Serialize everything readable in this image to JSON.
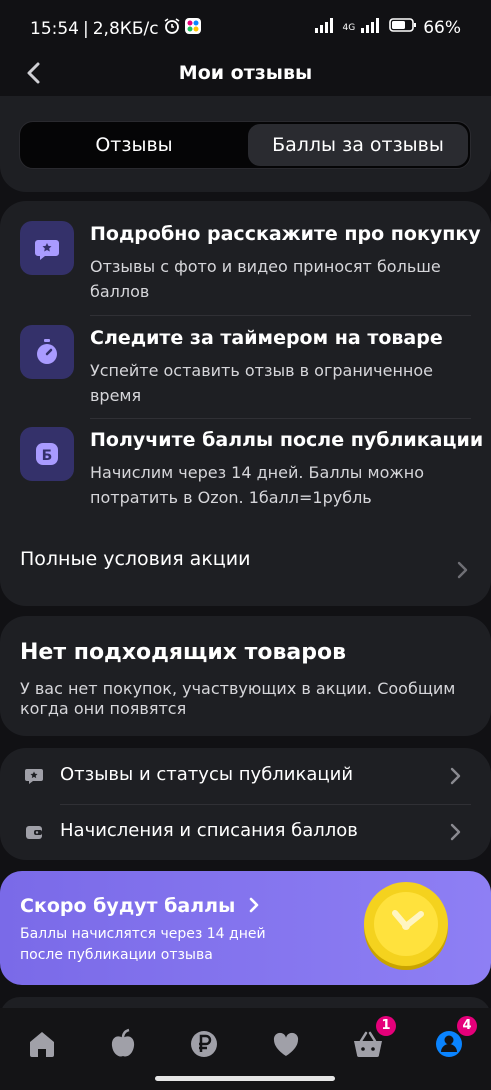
{
  "status_bar": {
    "time": "15:54",
    "speed": "2,8КБ/с",
    "network": "4G",
    "battery": "66%"
  },
  "header": {
    "title": "Мои отзывы"
  },
  "tabs": [
    {
      "label": "Отзывы",
      "active": false
    },
    {
      "label": "Баллы за отзывы",
      "active": true
    }
  ],
  "info": {
    "rows": [
      {
        "title": "Подробно расскажите про покупку",
        "text": "Отзывы с фото и видео приносят больше баллов",
        "icon": "star-chat-icon"
      },
      {
        "title": "Следите за таймером на товаре",
        "text": "Успейте оставить отзыв в ограниченное время",
        "icon": "stopwatch-icon"
      },
      {
        "title": "Получите баллы после публикации",
        "text": "Начислим через 14 дней. Баллы можно потратить в Ozon. 1балл=1рубль",
        "icon": "ruble-b-icon",
        "icon_letter": "Б"
      }
    ],
    "conditions_label": "Полные условия акции"
  },
  "no_products": {
    "title": "Нет подходящих товаров",
    "text": "У вас нет покупок, участвующих в акции. Сообщим когда они появятся"
  },
  "links": [
    {
      "label": "Отзывы и статусы публикаций",
      "icon": "star-chat-icon"
    },
    {
      "label": "Начисления и списания баллов",
      "icon": "wallet-icon"
    }
  ],
  "promo": {
    "title": "Скоро будут баллы",
    "text": "Баллы начислятся через 14 дней после публикации отзыва",
    "background": "#8576f0"
  },
  "nav": [
    {
      "name": "home-icon"
    },
    {
      "name": "fresh-icon"
    },
    {
      "name": "ruble-icon"
    },
    {
      "name": "heart-icon"
    },
    {
      "name": "basket-icon",
      "badge": "1"
    },
    {
      "name": "profile-icon",
      "badge": "4"
    }
  ],
  "colors": {
    "accent": "#0a84ff",
    "badge": "#e5007a",
    "card": "#1e1f23",
    "icon_bg": "#34316a"
  }
}
